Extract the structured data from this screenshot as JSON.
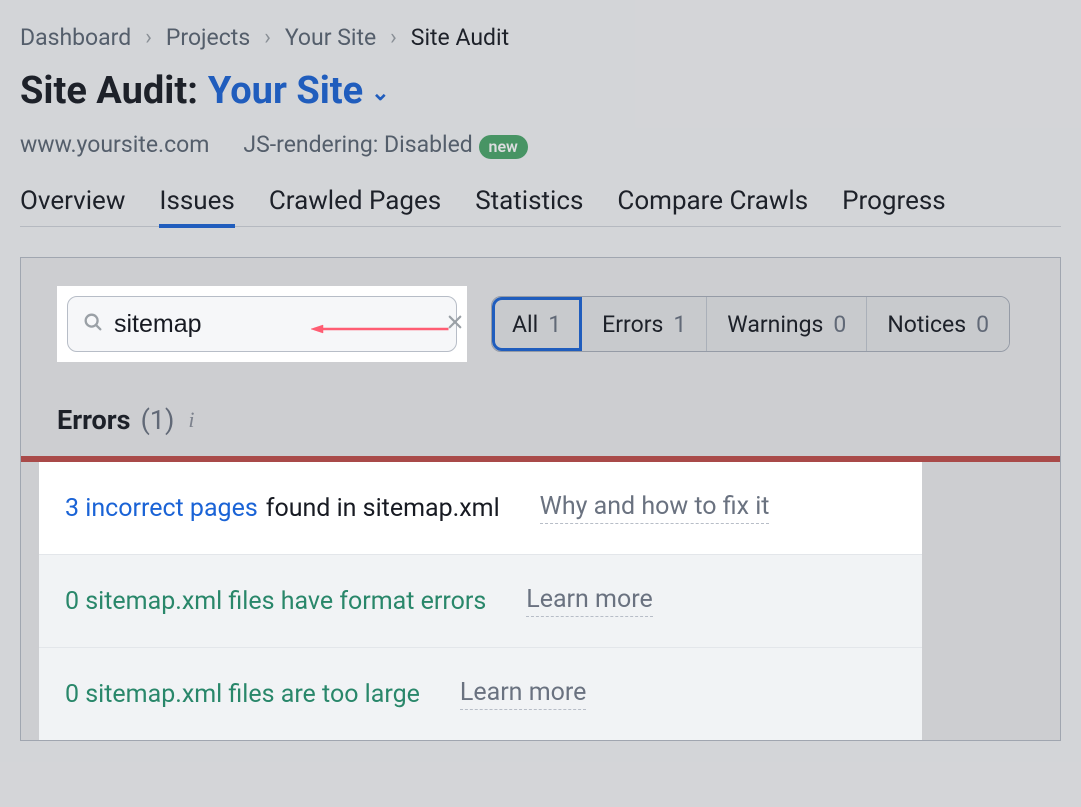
{
  "breadcrumbs": {
    "items": [
      "Dashboard",
      "Projects",
      "Your Site",
      "Site Audit"
    ]
  },
  "title": {
    "prefix": "Site Audit:",
    "site_name": "Your Site"
  },
  "subinfo": {
    "domain": "www.yoursite.com",
    "js_rendering_label": "JS-rendering: Disabled",
    "new_badge": "new"
  },
  "tabs": {
    "items": [
      "Overview",
      "Issues",
      "Crawled Pages",
      "Statistics",
      "Compare Crawls",
      "Progress"
    ],
    "active_index": 1
  },
  "search": {
    "value": "sitemap"
  },
  "filters": {
    "items": [
      {
        "label": "All",
        "count": "1"
      },
      {
        "label": "Errors",
        "count": "1"
      },
      {
        "label": "Warnings",
        "count": "0"
      },
      {
        "label": "Notices",
        "count": "0"
      }
    ],
    "selected_index": 0
  },
  "section": {
    "label": "Errors",
    "count": "(1)"
  },
  "issues": [
    {
      "link_text": "3 incorrect pages",
      "rest": "found in sitemap.xml",
      "help": "Why and how to fix it",
      "style": "blue",
      "muted": false
    },
    {
      "link_text": "0 sitemap.xml files have format errors",
      "rest": "",
      "help": "Learn more",
      "style": "green",
      "muted": true
    },
    {
      "link_text": "0 sitemap.xml files are too large",
      "rest": "",
      "help": "Learn more",
      "style": "green",
      "muted": true
    }
  ]
}
